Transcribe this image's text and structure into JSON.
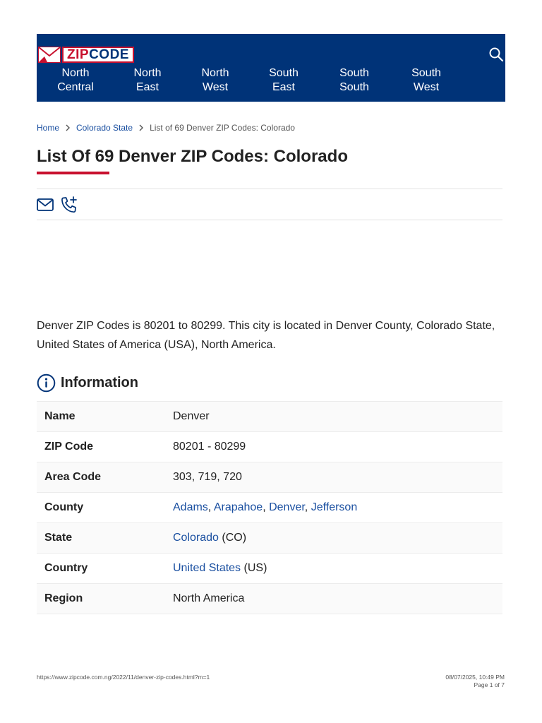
{
  "header": {
    "logo_left": "ZIP",
    "logo_right": "CODE",
    "nav": [
      {
        "line1": "North",
        "line2": "Central"
      },
      {
        "line1": "North",
        "line2": "East"
      },
      {
        "line1": "North",
        "line2": "West"
      },
      {
        "line1": "South",
        "line2": "East"
      },
      {
        "line1": "South",
        "line2": "South"
      },
      {
        "line1": "South",
        "line2": "West"
      }
    ],
    "search_icon": "search-icon",
    "colors": {
      "bar": "#003378",
      "accent": "#c8102e"
    }
  },
  "breadcrumb": {
    "home": "Home",
    "state": "Colorado State",
    "current": "List of 69 Denver ZIP Codes: Colorado"
  },
  "page": {
    "title": "List Of 69 Denver ZIP Codes: Colorado",
    "intro": "Denver ZIP Codes is 80201 to 80299. This city is located in Denver County, Colorado State, United States of America (USA), North America."
  },
  "information": {
    "heading": "Information",
    "rows": {
      "name": {
        "label": "Name",
        "value": "Denver"
      },
      "zip": {
        "label": "ZIP Code",
        "value": "80201 - 80299"
      },
      "area": {
        "label": "Area Code",
        "value": "303, 719, 720"
      },
      "county": {
        "label": "County",
        "links": [
          "Adams",
          "Arapahoe",
          "Denver",
          "Jefferson"
        ],
        "sep": ", "
      },
      "state": {
        "label": "State",
        "link": "Colorado",
        "suffix": " (CO)"
      },
      "country": {
        "label": "Country",
        "link": "United States",
        "suffix": " (US)"
      },
      "region": {
        "label": "Region",
        "value": "North America"
      }
    }
  },
  "footer": {
    "url": "https://www.zipcode.com.ng/2022/11/denver-zip-codes.html?m=1",
    "datetime": "08/07/2025, 10:49 PM",
    "page": "Page 1 of 7"
  }
}
